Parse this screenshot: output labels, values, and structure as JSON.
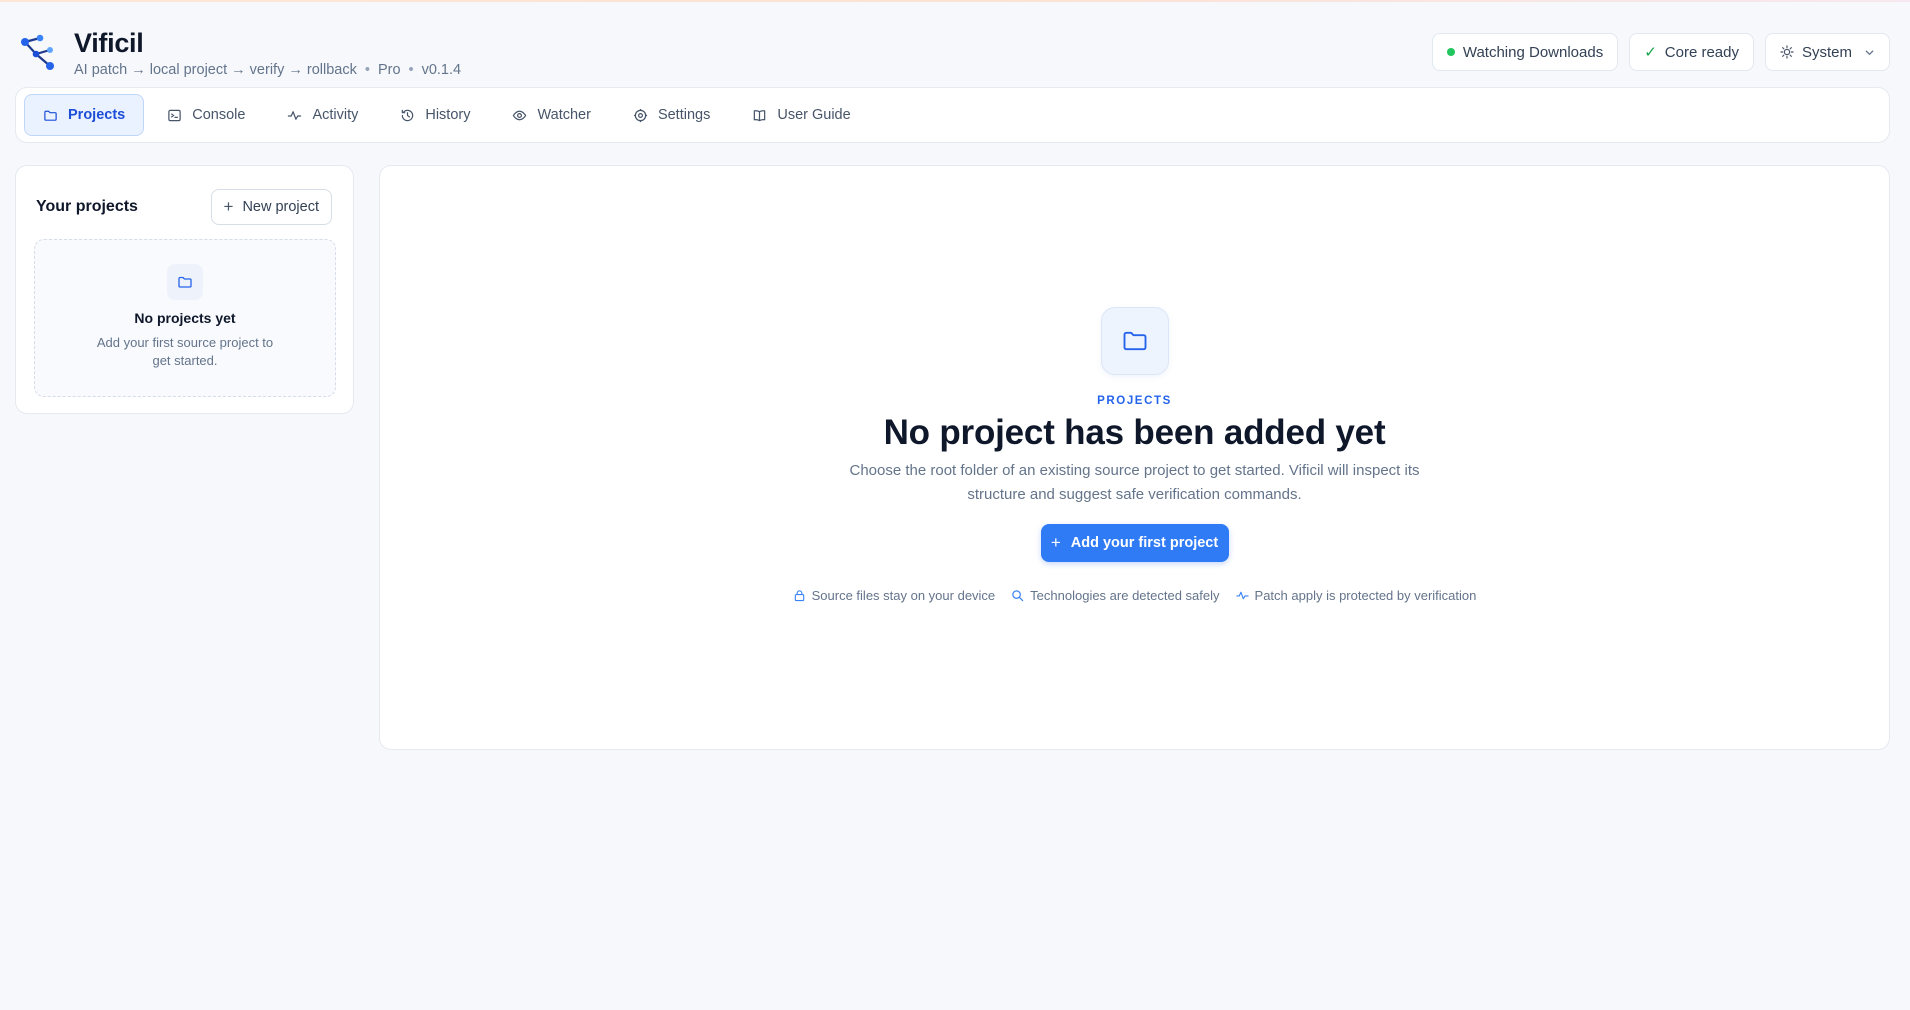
{
  "app": {
    "name": "Vificil",
    "tagline": "AI patch → local project → verify → rollback",
    "plan": "Pro",
    "version": "v0.1.4"
  },
  "header": {
    "watcher_status": "Watching Downloads",
    "core_status": "Core ready",
    "theme": "System"
  },
  "nav": {
    "tabs": [
      {
        "label": "Projects",
        "icon": "folder-icon",
        "active": true
      },
      {
        "label": "Console",
        "icon": "terminal-icon"
      },
      {
        "label": "Activity",
        "icon": "activity-icon"
      },
      {
        "label": "History",
        "icon": "history-icon"
      },
      {
        "label": "Watcher",
        "icon": "eye-icon"
      },
      {
        "label": "Settings",
        "icon": "gear-icon"
      },
      {
        "label": "User Guide",
        "icon": "book-icon"
      }
    ]
  },
  "sidebar": {
    "title": "Your projects",
    "new_button": "New project",
    "empty_title": "No projects yet",
    "empty_desc": "Add your first source project to get started."
  },
  "main": {
    "eyebrow": "PROJECTS",
    "title": "No project has been added yet",
    "description": "Choose the root folder of an existing source project to get started. Vificil will inspect its structure and suggest safe verification commands.",
    "cta": "Add your first project",
    "features": [
      {
        "icon": "lock-icon",
        "label": "Source files stay on your device"
      },
      {
        "icon": "search-icon",
        "label": "Technologies are detected safely"
      },
      {
        "icon": "activity-icon",
        "label": "Patch apply is protected by verification"
      }
    ]
  },
  "colors": {
    "accent": "#2f7af5",
    "status_green": "#22c55e",
    "background": "#f6f8fc"
  }
}
